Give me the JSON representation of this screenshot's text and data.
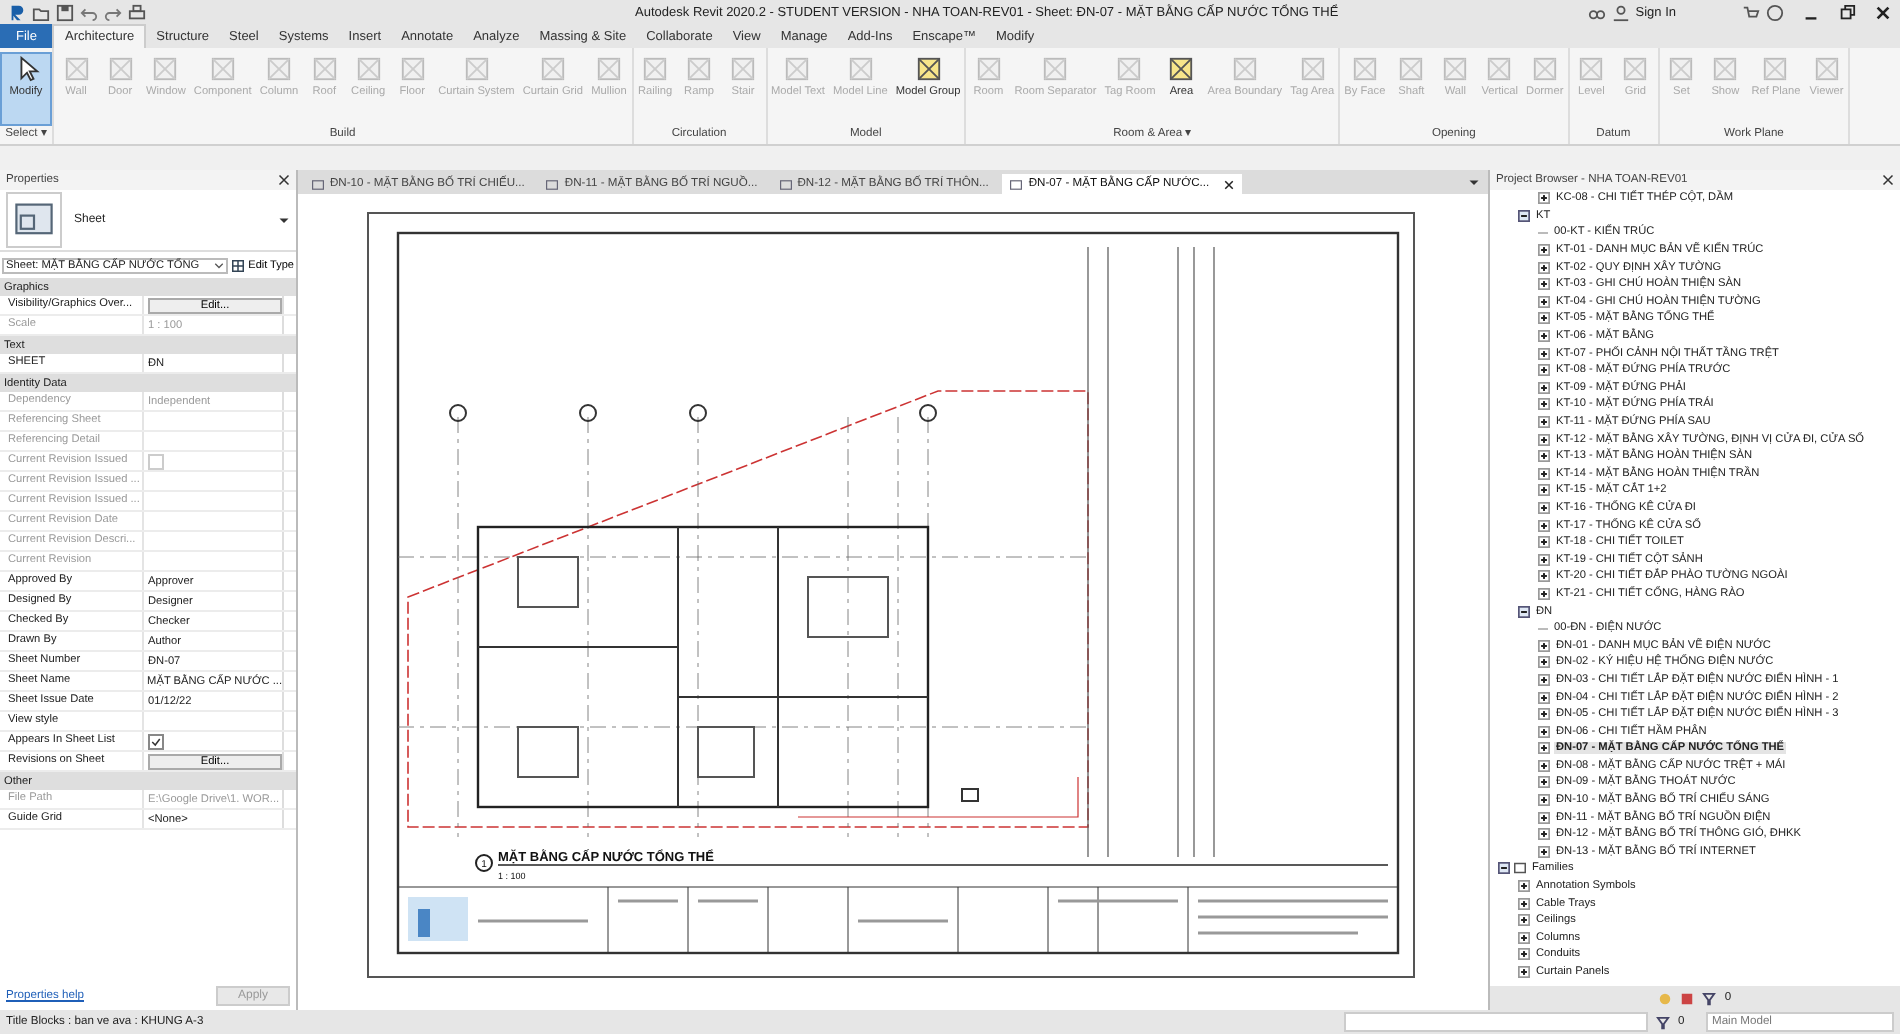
{
  "window": {
    "title": "Autodesk Revit 2020.2 - STUDENT VERSION - NHA TOAN-REV01 - Sheet: ĐN-07 - MẶT BẰNG CẤP NƯỚC TỔNG THỂ",
    "sign_in": "Sign In"
  },
  "ribbon_tabs": [
    {
      "label": "File",
      "selected": false,
      "kind": "file"
    },
    {
      "label": "Architecture",
      "selected": true,
      "kind": "tab"
    },
    {
      "label": "Structure",
      "selected": false,
      "kind": "tab"
    },
    {
      "label": "Steel",
      "selected": false,
      "kind": "tab"
    },
    {
      "label": "Systems",
      "selected": false,
      "kind": "tab"
    },
    {
      "label": "Insert",
      "selected": false,
      "kind": "tab"
    },
    {
      "label": "Annotate",
      "selected": false,
      "kind": "tab"
    },
    {
      "label": "Analyze",
      "selected": false,
      "kind": "tab"
    },
    {
      "label": "Massing & Site",
      "selected": false,
      "kind": "tab"
    },
    {
      "label": "Collaborate",
      "selected": false,
      "kind": "tab"
    },
    {
      "label": "View",
      "selected": false,
      "kind": "tab"
    },
    {
      "label": "Manage",
      "selected": false,
      "kind": "tab"
    },
    {
      "label": "Add-Ins",
      "selected": false,
      "kind": "tab"
    },
    {
      "label": "Enscape™",
      "selected": false,
      "kind": "tab"
    },
    {
      "label": "Modify",
      "selected": false,
      "kind": "tab"
    }
  ],
  "ribbon_groups": [
    {
      "label": "Select ▾",
      "tools": [
        {
          "label": "Modify",
          "disabled": false,
          "selected": true
        }
      ]
    },
    {
      "label": "Build",
      "tools": [
        {
          "label": "Wall",
          "disabled": true,
          "selected": false
        },
        {
          "label": "Door",
          "disabled": true,
          "selected": false
        },
        {
          "label": "Window",
          "disabled": true,
          "selected": false
        },
        {
          "label": "Component",
          "disabled": true,
          "selected": false
        },
        {
          "label": "Column",
          "disabled": true,
          "selected": false
        },
        {
          "label": "Roof",
          "disabled": true,
          "selected": false
        },
        {
          "label": "Ceiling",
          "disabled": true,
          "selected": false
        },
        {
          "label": "Floor",
          "disabled": true,
          "selected": false
        },
        {
          "label": "Curtain System",
          "disabled": true,
          "selected": false
        },
        {
          "label": "Curtain Grid",
          "disabled": true,
          "selected": false
        },
        {
          "label": "Mullion",
          "disabled": true,
          "selected": false
        }
      ]
    },
    {
      "label": "Circulation",
      "tools": [
        {
          "label": "Railing",
          "disabled": true,
          "selected": false
        },
        {
          "label": "Ramp",
          "disabled": true,
          "selected": false
        },
        {
          "label": "Stair",
          "disabled": true,
          "selected": false
        }
      ]
    },
    {
      "label": "Model",
      "tools": [
        {
          "label": "Model Text",
          "disabled": true,
          "selected": false
        },
        {
          "label": "Model Line",
          "disabled": true,
          "selected": false
        },
        {
          "label": "Model Group",
          "disabled": false,
          "selected": false
        }
      ]
    },
    {
      "label": "Room & Area ▾",
      "tools": [
        {
          "label": "Room",
          "disabled": true,
          "selected": false
        },
        {
          "label": "Room Separator",
          "disabled": true,
          "selected": false
        },
        {
          "label": "Tag Room",
          "disabled": true,
          "selected": false
        },
        {
          "label": "Area",
          "disabled": false,
          "selected": false
        },
        {
          "label": "Area Boundary",
          "disabled": true,
          "selected": false
        },
        {
          "label": "Tag Area",
          "disabled": true,
          "selected": false
        }
      ]
    },
    {
      "label": "Opening",
      "tools": [
        {
          "label": "By Face",
          "disabled": true,
          "selected": false
        },
        {
          "label": "Shaft",
          "disabled": true,
          "selected": false
        },
        {
          "label": "Wall",
          "disabled": true,
          "selected": false
        },
        {
          "label": "Vertical",
          "disabled": true,
          "selected": false
        },
        {
          "label": "Dormer",
          "disabled": true,
          "selected": false
        }
      ]
    },
    {
      "label": "Datum",
      "tools": [
        {
          "label": "Level",
          "disabled": true,
          "selected": false
        },
        {
          "label": "Grid",
          "disabled": true,
          "selected": false
        }
      ]
    },
    {
      "label": "Work Plane",
      "tools": [
        {
          "label": "Set",
          "disabled": true,
          "selected": false
        },
        {
          "label": "Show",
          "disabled": true,
          "selected": false
        },
        {
          "label": "Ref Plane",
          "disabled": true,
          "selected": false
        },
        {
          "label": "Viewer",
          "disabled": true,
          "selected": false
        }
      ]
    }
  ],
  "properties": {
    "title": "Properties",
    "type_name": "Sheet",
    "selector": "Sheet: MẶT BẰNG CẤP NƯỚC TỔNG",
    "edit_type": "Edit Type",
    "rows": [
      {
        "kind": "section",
        "label": "Graphics"
      },
      {
        "kind": "button",
        "label": "Visibility/Graphics Over...",
        "value": "Edit...",
        "disabled": false
      },
      {
        "kind": "text",
        "label": "Scale",
        "value": "1 : 100",
        "disabled": true
      },
      {
        "kind": "section",
        "label": "Text"
      },
      {
        "kind": "text",
        "label": "SHEET",
        "value": "ĐN",
        "disabled": false
      },
      {
        "kind": "section",
        "label": "Identity Data"
      },
      {
        "kind": "text",
        "label": "Dependency",
        "value": "Independent",
        "disabled": true
      },
      {
        "kind": "text",
        "label": "Referencing Sheet",
        "disabled": true
      },
      {
        "kind": "text",
        "label": "Referencing Detail",
        "disabled": true
      },
      {
        "kind": "checkbox",
        "label": "Current Revision Issued",
        "checked": false,
        "disabled": true
      },
      {
        "kind": "text",
        "label": "Current Revision Issued ...",
        "disabled": true
      },
      {
        "kind": "text",
        "label": "Current Revision Issued ...",
        "disabled": true
      },
      {
        "kind": "text",
        "label": "Current Revision Date",
        "disabled": true
      },
      {
        "kind": "text",
        "label": "Current Revision Descri...",
        "disabled": true
      },
      {
        "kind": "text",
        "label": "Current Revision",
        "disabled": true
      },
      {
        "kind": "text",
        "label": "Approved By",
        "value": "Approver",
        "disabled": false
      },
      {
        "kind": "text",
        "label": "Designed By",
        "value": "Designer",
        "disabled": false
      },
      {
        "kind": "text",
        "label": "Checked By",
        "value": "Checker",
        "disabled": false
      },
      {
        "kind": "text",
        "label": "Drawn By",
        "value": "Author",
        "disabled": false
      },
      {
        "kind": "text",
        "label": "Sheet Number",
        "value": "ĐN-07",
        "disabled": false
      },
      {
        "kind": "text",
        "label": "Sheet Name",
        "value": "MẶT BẰNG CẤP NƯỚC ...",
        "disabled": false
      },
      {
        "kind": "text",
        "label": "Sheet Issue Date",
        "value": "01/12/22",
        "disabled": false
      },
      {
        "kind": "text",
        "label": "View style",
        "disabled": false
      },
      {
        "kind": "checkbox",
        "label": "Appears In Sheet List",
        "checked": true,
        "disabled": false
      },
      {
        "kind": "button",
        "label": "Revisions on Sheet",
        "value": "Edit...",
        "disabled": false
      },
      {
        "kind": "section",
        "label": "Other"
      },
      {
        "kind": "text",
        "label": "File Path",
        "value": "E:\\Google Drive\\1. WOR...",
        "disabled": true
      },
      {
        "kind": "text",
        "label": "Guide Grid",
        "value": "<None>",
        "disabled": false
      }
    ],
    "help": "Properties help",
    "apply": "Apply"
  },
  "doc_tabs": [
    {
      "label": "ĐN-10 - MẶT BẰNG BỐ TRÍ CHIẾU...",
      "selected": false
    },
    {
      "label": "ĐN-11 - MẶT BẰNG BỐ TRÍ NGUỒ...",
      "selected": false
    },
    {
      "label": "ĐN-12 - MẶT BẰNG BỐ TRÍ THÔN...",
      "selected": false
    },
    {
      "label": "ĐN-07 - MẶT BẰNG CẤP NƯỚC...",
      "selected": true
    }
  ],
  "sheet": {
    "plan_title": "MẶT BẰNG CẤP NƯỚC TỔNG THỂ",
    "scale": "1 : 100",
    "view_number": "1"
  },
  "project_browser": {
    "title": "Project Browser - NHA TOAN-REV01",
    "scrolled_children": [
      {
        "label": "KC-08 - CHI TIẾT THÉP CỘT, DẦM",
        "expanded": false,
        "selected": false
      }
    ],
    "groups": [
      {
        "label": "KT",
        "expanded": true,
        "selected": false,
        "children": [
          {
            "label": "00-KT - KIẾN TRÚC",
            "selected": false
          },
          {
            "label": "KT-01 - DANH MỤC BẢN VẼ KIẾN TRÚC",
            "expanded": false,
            "selected": false
          },
          {
            "label": "KT-02 - QUY ĐỊNH XÂY TƯỜNG",
            "expanded": false,
            "selected": false
          },
          {
            "label": "KT-03 - GHI CHÚ HOÀN THIỆN SÀN",
            "expanded": false,
            "selected": false
          },
          {
            "label": "KT-04 - GHI CHÚ HOÀN THIỆN TƯỜNG",
            "expanded": false,
            "selected": false
          },
          {
            "label": "KT-05 - MẶT BẰNG TỔNG THỂ",
            "expanded": false,
            "selected": false
          },
          {
            "label": "KT-06 - MẶT BẰNG",
            "expanded": false,
            "selected": false
          },
          {
            "label": "KT-07 - PHỐI CẢNH NỘI THẤT TẦNG TRỆT",
            "expanded": false,
            "selected": false
          },
          {
            "label": "KT-08 - MẶT ĐỨNG PHÍA TRƯỚC",
            "expanded": false,
            "selected": false
          },
          {
            "label": "KT-09 - MẶT ĐỨNG PHẢI",
            "expanded": false,
            "selected": false
          },
          {
            "label": "KT-10 - MẶT ĐỨNG PHÍA TRÁI",
            "expanded": false,
            "selected": false
          },
          {
            "label": "KT-11 - MẶT ĐỨNG PHÍA SAU",
            "expanded": false,
            "selected": false
          },
          {
            "label": "KT-12 - MẶT BẰNG XÂY TƯỜNG, ĐỊNH VỊ CỬA ĐI, CỬA SỔ",
            "expanded": false,
            "selected": false
          },
          {
            "label": "KT-13 - MẶT BẰNG HOÀN THIỆN SÀN",
            "expanded": false,
            "selected": false
          },
          {
            "label": "KT-14 - MẶT BẰNG HOÀN THIỆN TRẦN",
            "expanded": false,
            "selected": false
          },
          {
            "label": "KT-15 - MẶT CẮT 1+2",
            "expanded": false,
            "selected": false
          },
          {
            "label": "KT-16 - THỐNG KÊ CỬA ĐI",
            "expanded": false,
            "selected": false
          },
          {
            "label": "KT-17 - THỐNG KÊ CỬA SỔ",
            "expanded": false,
            "selected": false
          },
          {
            "label": "KT-18 - CHI TIẾT TOILET",
            "expanded": false,
            "selected": false
          },
          {
            "label": "KT-19 - CHI TIẾT CỘT SẢNH",
            "expanded": false,
            "selected": false
          },
          {
            "label": "KT-20 - CHI TIẾT ĐẮP PHÀO TƯỜNG NGOÀI",
            "expanded": false,
            "selected": false
          },
          {
            "label": "KT-21 - CHI TIẾT CỔNG, HÀNG RÀO",
            "expanded": false,
            "selected": false
          }
        ]
      },
      {
        "label": "ĐN",
        "expanded": true,
        "selected": false,
        "children": [
          {
            "label": "00-ĐN - ĐIỆN NƯỚC",
            "selected": false
          },
          {
            "label": "ĐN-01 - DANH MỤC BẢN VẼ ĐIỆN NƯỚC",
            "expanded": false,
            "selected": false
          },
          {
            "label": "ĐN-02 - KÝ HIỆU HỆ THỐNG ĐIỆN NƯỚC",
            "expanded": false,
            "selected": false
          },
          {
            "label": "ĐN-03 - CHI TIẾT LẮP ĐẶT ĐIỆN NƯỚC ĐIỂN HÌNH - 1",
            "expanded": false,
            "selected": false
          },
          {
            "label": "ĐN-04 - CHI TIẾT LẮP ĐẶT ĐIỆN NƯỚC ĐIỂN HÌNH - 2",
            "expanded": false,
            "selected": false
          },
          {
            "label": "ĐN-05 - CHI TIẾT LẮP ĐẶT ĐIỆN NƯỚC ĐIỂN HÌNH - 3",
            "expanded": false,
            "selected": false
          },
          {
            "label": "ĐN-06 - CHI TIẾT HẦM PHÂN",
            "expanded": false,
            "selected": false
          },
          {
            "label": "ĐN-07 - MẶT BẰNG CẤP NƯỚC TỔNG THỂ",
            "expanded": false,
            "selected": true
          },
          {
            "label": "ĐN-08 - MẶT BẰNG CẤP NƯỚC TRỆT + MÁI",
            "expanded": false,
            "selected": false
          },
          {
            "label": "ĐN-09 - MẶT BẰNG THOÁT NƯỚC",
            "expanded": false,
            "selected": false
          },
          {
            "label": "ĐN-10 - MẶT BẰNG BỐ TRÍ CHIẾU SÁNG",
            "expanded": false,
            "selected": false
          },
          {
            "label": "ĐN-11 - MẶT BẰNG BỐ TRÍ NGUỒN ĐIỆN",
            "expanded": false,
            "selected": false
          },
          {
            "label": "ĐN-12 - MẶT BẰNG BỐ TRÍ THÔNG GIÓ, ĐHKK",
            "expanded": false,
            "selected": false
          },
          {
            "label": "ĐN-13 - MẶT BẰNG BỐ TRÍ INTERNET",
            "expanded": false,
            "selected": false
          }
        ]
      }
    ],
    "families": {
      "label": "Families",
      "expanded": true,
      "selected": false,
      "children": [
        {
          "label": "Annotation Symbols",
          "expanded": false,
          "selected": false
        },
        {
          "label": "Cable Trays",
          "expanded": false,
          "selected": false
        },
        {
          "label": "Ceilings",
          "expanded": false,
          "selected": false
        },
        {
          "label": "Columns",
          "expanded": false,
          "selected": false
        },
        {
          "label": "Conduits",
          "expanded": false,
          "selected": false
        },
        {
          "label": "Curtain Panels",
          "expanded": false,
          "selected": false
        }
      ]
    },
    "filter_count": "0"
  },
  "status_bar": {
    "text": "Title Blocks : ban ve ava : KHUNG A-3",
    "count": "0",
    "model": "Main Model"
  }
}
